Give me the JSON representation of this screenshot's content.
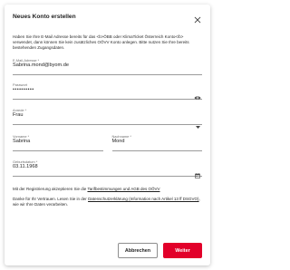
{
  "dialog": {
    "title": "Neues Konto erstellen",
    "intro": "Haben Sie Ihre E-Mail Adresse bereits für das <b>ÖBB oder KlimaTicket Österreich Konto</b> verwendet, dann können Sie kein zusätzliches OÖVV Konto anlegen. Bitte nutzen Sie Ihre bereits bestehenden Zugangsdaten."
  },
  "form": {
    "email": {
      "label": "E-Mail-Adresse *",
      "value": "Sabrina.mond@byom.de"
    },
    "password": {
      "label": "Passwort",
      "value": "••••••••••"
    },
    "salutation": {
      "label": "Anrede *",
      "value": "Frau"
    },
    "first_name": {
      "label": "Vorname *",
      "value": "Sabrina"
    },
    "last_name": {
      "label": "Nachname *",
      "value": "Mond"
    },
    "birthdate": {
      "label": "Geburtsdatum *",
      "value": "03.11.1968"
    }
  },
  "consent": {
    "prefix": "Mit der Registrierung akzeptieren Sie die ",
    "link": "Tarifbestimmungen und AGB des OÖVV"
  },
  "thanks": {
    "prefix": "Danke für Ihr Vertrauen. Lesen Sie in der ",
    "link": "Datenschutzerklärung (Information nach Artikel 13 ff DSGVO)",
    "suffix": ", wie wir Ihre Daten verarbeiten."
  },
  "buttons": {
    "cancel": "Abbrechen",
    "next": "Weiter"
  },
  "colors": {
    "primary": "#e2002a",
    "text": "#1f1f1f",
    "field_underline": "#9b9b9b"
  },
  "icons": {
    "close": "close-icon",
    "password_visibility": "eye-icon",
    "dropdown": "chevron-down-icon",
    "date_picker": "calendar-icon"
  }
}
